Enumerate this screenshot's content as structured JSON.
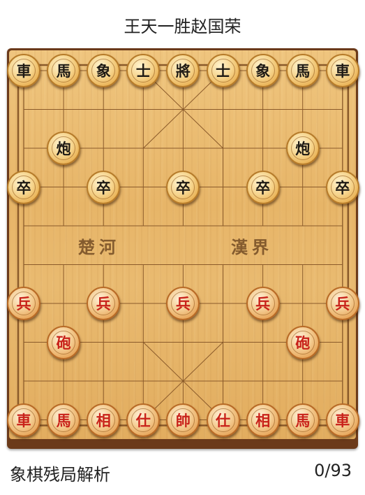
{
  "title": "王天一胜赵国荣",
  "river": {
    "left": "楚河",
    "right": "漢界"
  },
  "footer": {
    "label": "象棋残局解析",
    "counter": "0/93"
  },
  "pieces": [
    {
      "id": "b-rook-l",
      "char": "車",
      "side": "black",
      "col": 0,
      "row": 0
    },
    {
      "id": "b-horse-l",
      "char": "馬",
      "side": "black",
      "col": 1,
      "row": 0
    },
    {
      "id": "b-elephant-l",
      "char": "象",
      "side": "black",
      "col": 2,
      "row": 0
    },
    {
      "id": "b-advisor-l",
      "char": "士",
      "side": "black",
      "col": 3,
      "row": 0
    },
    {
      "id": "b-general",
      "char": "將",
      "side": "black",
      "col": 4,
      "row": 0
    },
    {
      "id": "b-advisor-r",
      "char": "士",
      "side": "black",
      "col": 5,
      "row": 0
    },
    {
      "id": "b-elephant-r",
      "char": "象",
      "side": "black",
      "col": 6,
      "row": 0
    },
    {
      "id": "b-horse-r",
      "char": "馬",
      "side": "black",
      "col": 7,
      "row": 0
    },
    {
      "id": "b-rook-r",
      "char": "車",
      "side": "black",
      "col": 8,
      "row": 0
    },
    {
      "id": "b-cannon-l",
      "char": "炮",
      "side": "black",
      "col": 1,
      "row": 2
    },
    {
      "id": "b-cannon-r",
      "char": "炮",
      "side": "black",
      "col": 7,
      "row": 2
    },
    {
      "id": "b-soldier-1",
      "char": "卒",
      "side": "black",
      "col": 0,
      "row": 3
    },
    {
      "id": "b-soldier-2",
      "char": "卒",
      "side": "black",
      "col": 2,
      "row": 3
    },
    {
      "id": "b-soldier-3",
      "char": "卒",
      "side": "black",
      "col": 4,
      "row": 3
    },
    {
      "id": "b-soldier-4",
      "char": "卒",
      "side": "black",
      "col": 6,
      "row": 3
    },
    {
      "id": "b-soldier-5",
      "char": "卒",
      "side": "black",
      "col": 8,
      "row": 3
    },
    {
      "id": "r-soldier-1",
      "char": "兵",
      "side": "red",
      "col": 0,
      "row": 6
    },
    {
      "id": "r-soldier-2",
      "char": "兵",
      "side": "red",
      "col": 2,
      "row": 6
    },
    {
      "id": "r-soldier-3",
      "char": "兵",
      "side": "red",
      "col": 4,
      "row": 6
    },
    {
      "id": "r-soldier-4",
      "char": "兵",
      "side": "red",
      "col": 6,
      "row": 6
    },
    {
      "id": "r-soldier-5",
      "char": "兵",
      "side": "red",
      "col": 8,
      "row": 6
    },
    {
      "id": "r-cannon-l",
      "char": "砲",
      "side": "red",
      "col": 1,
      "row": 7
    },
    {
      "id": "r-cannon-r",
      "char": "砲",
      "side": "red",
      "col": 7,
      "row": 7
    },
    {
      "id": "r-rook-l",
      "char": "車",
      "side": "red",
      "col": 0,
      "row": 9
    },
    {
      "id": "r-horse-l",
      "char": "馬",
      "side": "red",
      "col": 1,
      "row": 9
    },
    {
      "id": "r-elephant-l",
      "char": "相",
      "side": "red",
      "col": 2,
      "row": 9
    },
    {
      "id": "r-advisor-l",
      "char": "仕",
      "side": "red",
      "col": 3,
      "row": 9
    },
    {
      "id": "r-general",
      "char": "帥",
      "side": "red",
      "col": 4,
      "row": 9
    },
    {
      "id": "r-advisor-r",
      "char": "仕",
      "side": "red",
      "col": 5,
      "row": 9
    },
    {
      "id": "r-elephant-r",
      "char": "相",
      "side": "red",
      "col": 6,
      "row": 9
    },
    {
      "id": "r-horse-r",
      "char": "馬",
      "side": "red",
      "col": 7,
      "row": 9
    },
    {
      "id": "r-rook-r",
      "char": "車",
      "side": "red",
      "col": 8,
      "row": 9
    }
  ]
}
